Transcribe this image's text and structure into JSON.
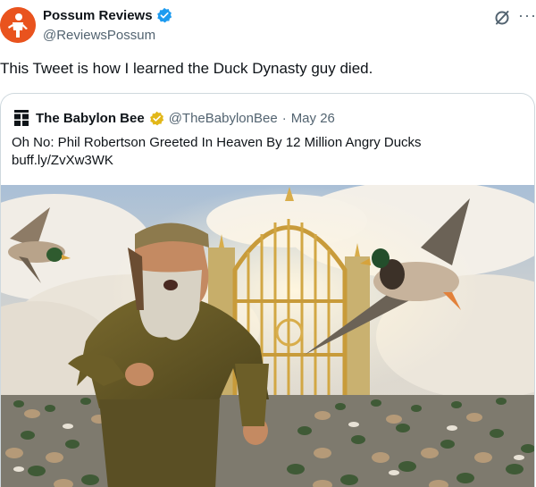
{
  "tweet": {
    "author": {
      "display_name": "Possum Reviews",
      "handle": "@ReviewsPossum"
    },
    "text": "This Tweet is how I learned the Duck Dynasty guy died."
  },
  "quoted_tweet": {
    "author": {
      "display_name": "The Babylon Bee",
      "handle": "@TheBabylonBee"
    },
    "separator": "·",
    "date": "May 26",
    "text_line1": "Oh No: Phil Robertson Greeted In Heaven By 12 Million Angry Ducks",
    "text_line2": "buff.ly/ZvXw3WK"
  },
  "icons": {
    "verified": "verified-badge-icon",
    "gold_verified": "gold-verified-badge-icon",
    "grok": "grok-icon",
    "more": "more-options-icon"
  },
  "colors": {
    "verified_blue": "#1d9bf0",
    "gold_badge": "#e2b719",
    "avatar_orange": "#e9531e",
    "link_gray": "#536471"
  }
}
